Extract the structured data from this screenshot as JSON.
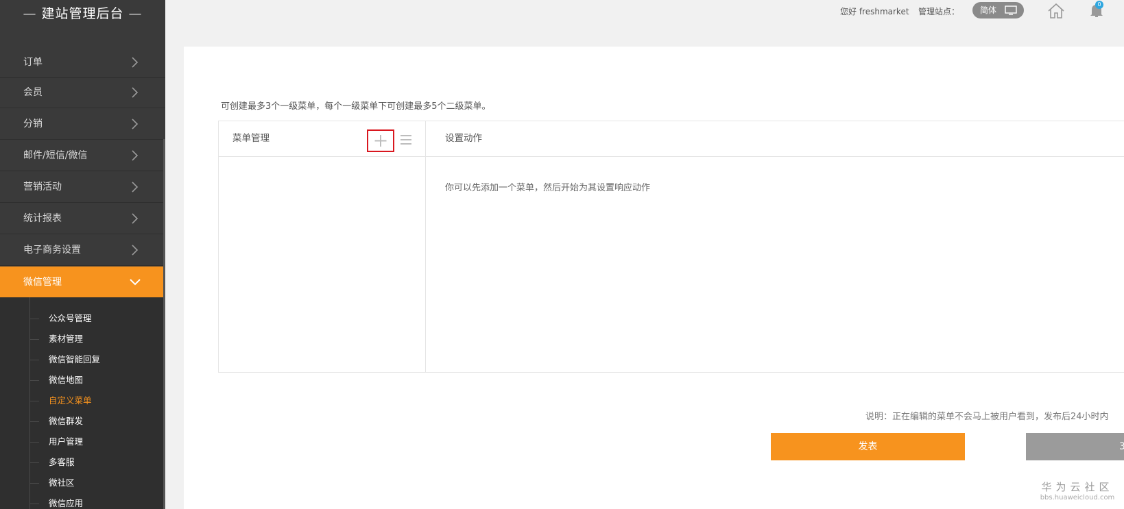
{
  "sidebar": {
    "logo": "建站管理后台",
    "items": [
      {
        "label": "订单"
      },
      {
        "label": "会员"
      },
      {
        "label": "分销"
      },
      {
        "label": "邮件/短信/微信"
      },
      {
        "label": "营销活动"
      },
      {
        "label": "统计报表"
      },
      {
        "label": "电子商务设置"
      },
      {
        "label": "微信管理"
      }
    ],
    "subitems": [
      {
        "label": "公众号管理"
      },
      {
        "label": "素材管理"
      },
      {
        "label": "微信智能回复"
      },
      {
        "label": "微信地图"
      },
      {
        "label": "自定义菜单"
      },
      {
        "label": "微信群发"
      },
      {
        "label": "用户管理"
      },
      {
        "label": "多客服"
      },
      {
        "label": "微社区"
      },
      {
        "label": "微信应用"
      }
    ]
  },
  "topbar": {
    "greeting": "您好 freshmarket",
    "site_label": "管理站点：",
    "lang_toggle": "简体",
    "notification_count": "0"
  },
  "main": {
    "hint": "可创建最多3个一级菜单，每个一级菜单下可创建最多5个二级菜单。",
    "menu_header": "菜单管理",
    "action_header": "设置动作",
    "empty_message": "你可以先添加一个菜单，然后开始为其设置响应动作",
    "note": "说明：正在编辑的菜单不会马上被用户看到，发布后24小时内",
    "publish_label": "发表",
    "second_button_label": "3"
  },
  "watermark": {
    "line1": "华为云社区",
    "line2": "bbs.huaweicloud.com"
  },
  "colors": {
    "accent": "#f7931e",
    "sidebar_bg": "#3a3a3a",
    "highlight_border": "#d9171f",
    "badge": "#2fa7e0"
  }
}
